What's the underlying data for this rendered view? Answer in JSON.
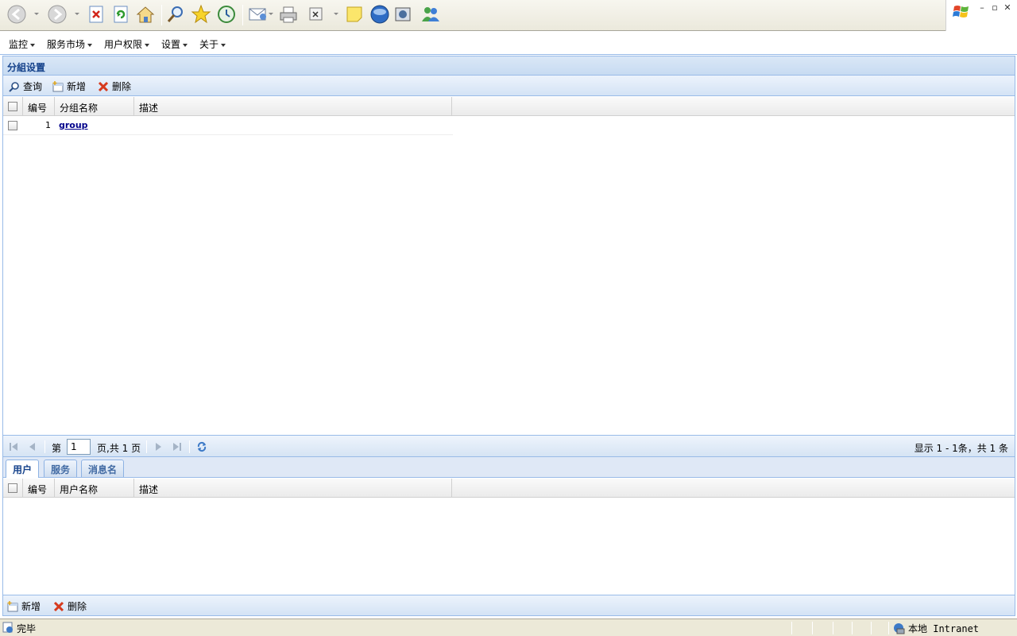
{
  "app_menu": {
    "items": [
      {
        "label": "监控"
      },
      {
        "label": "服务市场"
      },
      {
        "label": "用户权限"
      },
      {
        "label": "设置"
      },
      {
        "label": "关于"
      }
    ]
  },
  "panel": {
    "title": "分組设置",
    "toolbar": {
      "query_label": "查询",
      "add_label": "新增",
      "delete_label": "删除"
    },
    "grid": {
      "columns": [
        "编号",
        "分组名称",
        "描述"
      ],
      "rows": [
        {
          "id": "1",
          "name": "group",
          "description": ""
        }
      ]
    },
    "pager": {
      "page_prefix": "第",
      "page_value": "1",
      "page_suffix": "页,共 1 页",
      "summary": "显示 1 - 1条，共 1 条"
    }
  },
  "detail": {
    "tabs": [
      {
        "label": "用户"
      },
      {
        "label": "服务"
      },
      {
        "label": "消息名"
      }
    ],
    "grid": {
      "columns": [
        "编号",
        "用户名称",
        "描述"
      ]
    },
    "toolbar": {
      "add_label": "新增",
      "delete_label": "删除"
    }
  },
  "statusbar": {
    "status": "完毕",
    "zone": "本地 Intranet"
  },
  "colors": {
    "header_blue": "#15428b",
    "border_blue": "#99bbe8",
    "link_blue": "#00008b",
    "delete_red": "#d63a1e"
  }
}
